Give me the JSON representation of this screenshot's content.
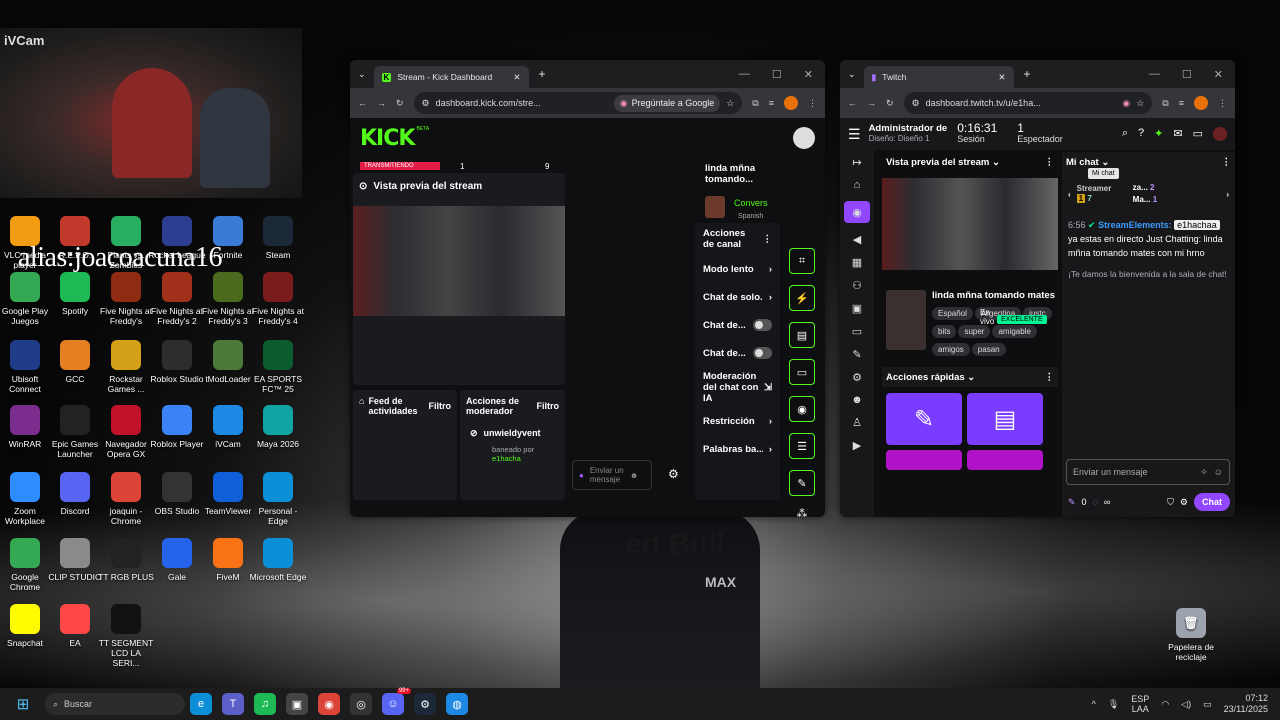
{
  "webcam": {
    "label": "iVCam"
  },
  "alias": "alias:joacoacuna16",
  "desktop_icons": [
    {
      "label": "VLC media player",
      "color": "#f39c12"
    },
    {
      "label": "R.E.P.O.",
      "color": "#c0392b"
    },
    {
      "label": "Plants vs. Zombies",
      "color": "#27ae60"
    },
    {
      "label": "Rocket League",
      "color": "#2c3e90"
    },
    {
      "label": "Fortnite",
      "color": "#3a7bd5"
    },
    {
      "label": "Steam",
      "color": "#1b2838"
    },
    {
      "label": "Google Play Juegos",
      "color": "#34a853"
    },
    {
      "label": "Spotify",
      "color": "#1db954"
    },
    {
      "label": "Five Nights at Freddy's",
      "color": "#8e2b12"
    },
    {
      "label": "Five Nights at Freddy's 2",
      "color": "#a0301a"
    },
    {
      "label": "Five Nights at Freddy's 3",
      "color": "#4a6b1e"
    },
    {
      "label": "Five Nights at Freddy's 4",
      "color": "#7a1c1c"
    },
    {
      "label": "Ubisoft Connect",
      "color": "#1f3c88"
    },
    {
      "label": "GCC",
      "color": "#e67e22"
    },
    {
      "label": "Rockstar Games ...",
      "color": "#d4a017"
    },
    {
      "label": "Roblox Studio",
      "color": "#2d2d2d"
    },
    {
      "label": "tModLoader",
      "color": "#4b7a3a"
    },
    {
      "label": "EA SPORTS FC™ 25",
      "color": "#0b5d2f"
    },
    {
      "label": "WinRAR",
      "color": "#7b2d8e"
    },
    {
      "label": "Epic Games Launcher",
      "color": "#222222"
    },
    {
      "label": "Navegador Opera GX",
      "color": "#c0102a"
    },
    {
      "label": "Roblox Player",
      "color": "#3b82f6"
    },
    {
      "label": "iVCam",
      "color": "#1e88e5"
    },
    {
      "label": "Maya 2026",
      "color": "#0ea5a4"
    },
    {
      "label": "Zoom Workplace",
      "color": "#2d8cff"
    },
    {
      "label": "Discord",
      "color": "#5865f2"
    },
    {
      "label": "joaquin - Chrome",
      "color": "#db4437"
    },
    {
      "label": "OBS Studio",
      "color": "#333333"
    },
    {
      "label": "TeamViewer",
      "color": "#0e5fd8"
    },
    {
      "label": "Personal - Edge",
      "color": "#0c8fd6"
    },
    {
      "label": "Google Chrome",
      "color": "#34a853"
    },
    {
      "label": "CLIP STUDIO",
      "color": "#8a8a8a"
    },
    {
      "label": "TT RGB PLUS",
      "color": "#222222"
    },
    {
      "label": "Gale",
      "color": "#2563eb"
    },
    {
      "label": "FiveM",
      "color": "#f97316"
    },
    {
      "label": "Microsoft Edge",
      "color": "#0c8fd6"
    },
    {
      "label": "Snapchat",
      "color": "#fffc00"
    },
    {
      "label": "EA",
      "color": "#ff4747"
    },
    {
      "label": "TT SEGMENT LCD LA SERI...",
      "color": "#111111"
    },
    {
      "label": "Papelera de reciclaje",
      "color": "#9ca3af"
    }
  ],
  "kick": {
    "tab_title": "Stream - Kick Dashboard",
    "url": "dashboard.kick.com/stre...",
    "ask_google": "Pregúntale a Google",
    "logo": "KICK",
    "logo_badge": "BETA",
    "live_badge": "TRANSMITIENDO",
    "stat1": "1",
    "stat2": "9",
    "preview_title": "Vista previa del stream",
    "feed_title": "Feed de actividades",
    "feed_filter": "Filtro",
    "mod_title": "Acciones de moderador",
    "mod_filter": "Filtro",
    "mod_user": "unwieldyvent",
    "mod_action": "baneado por",
    "mod_by": "e1hacha",
    "chat_placeholder": "Enviar un mensaje",
    "stream_title": "linda mñna tomando...",
    "conv_label": "Convers",
    "lang_label": "Spanish",
    "channel_actions": "Acciones de canal",
    "actions": [
      "Modo lento",
      "Chat de solo...",
      "Chat de...",
      "Chat de...",
      "Moderación del chat con IA",
      "Restricción",
      "Palabras ba..."
    ]
  },
  "twitch": {
    "tab_title": "Twitch",
    "url": "dashboard.twitch.tv/u/e1ha...",
    "admin_title": "Administrador de",
    "admin_sub": "Diseño: Diseño 1",
    "session_time": "0:16:31",
    "session_label": "Sesión",
    "viewers": "1",
    "viewers_label": "Espectador",
    "preview_title": "Vista previa del stream",
    "stream_title": "linda mñna tomando mates",
    "tags": [
      "Español",
      "Argentina",
      "justc",
      "bits",
      "super",
      "amigable",
      "amigos",
      "pasan"
    ],
    "live_word": "En vivo",
    "excellent": "EXCELENTE",
    "quick_actions": "Acciones rápidas",
    "chat_title": "Mi chat",
    "tooltip": "Mi chat",
    "streamer_label": "Streamer",
    "badge1_name": "za...",
    "badge1_count": "2",
    "badge2_name": "Ma...",
    "badge2_count": "1",
    "badge3_count": "1",
    "badge4_count": "7",
    "msg_time": "6:56",
    "msg_user": "StreamElements:",
    "msg_mention": "e1hachaa",
    "msg_text1": "ya estas en directo",
    "msg_text2": "Just Chatting: linda mñna tomando mates con mi hrno",
    "welcome": "¡Te damos la bienvenida a la sala de chat!",
    "input_placeholder": "Enviar un mensaje",
    "points": "0",
    "inf": "∞",
    "chat_button": "Chat"
  },
  "taskbar": {
    "search": "Buscar",
    "lang": "ESP",
    "lang2": "LAA",
    "time": "07:12",
    "date": "23/11/2025",
    "discord_badge": "99+"
  }
}
